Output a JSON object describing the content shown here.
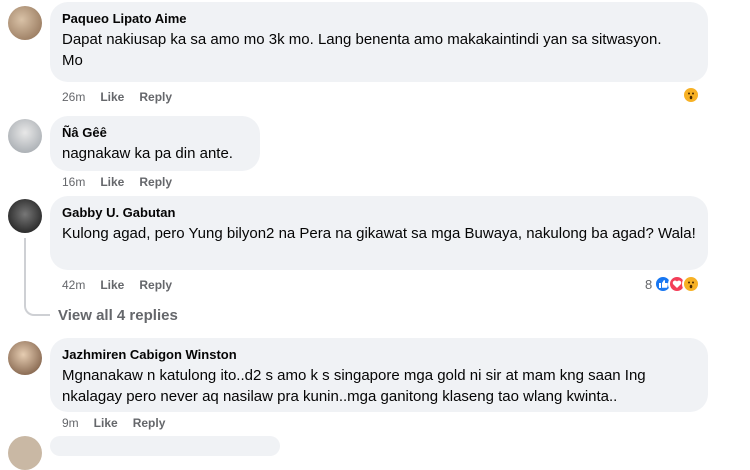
{
  "comments": [
    {
      "author": "Paqueo Lipato Aime",
      "text": "Dapat nakiusap ka sa amo mo 3k mo. Lang benenta amo makakaintindi yan sa sitwasyon. Mo",
      "time": "26m",
      "like": "Like",
      "reply": "Reply"
    },
    {
      "author": "Ñâ Gêê",
      "text": "nagnakaw ka pa din ante.",
      "time": "16m",
      "like": "Like",
      "reply": "Reply"
    },
    {
      "author": "Gabby U. Gabutan",
      "text": "Kulong agad, pero Yung bilyon2 na Pera na gikawat sa mga Buwaya, nakulong ba agad? Wala!",
      "time": "42m",
      "like": "Like",
      "reply": "Reply",
      "reaction_count": "8"
    },
    {
      "author": "Jazhmiren Cabigon Winston",
      "text": "Mgnanakaw n katulong ito..d2 s amo k s singapore mga gold ni sir at mam kng saan Ing nkalagay pero never aq nasilaw pra kunin..mga ganitong klaseng tao wlang kwinta..",
      "time": "9m",
      "like": "Like",
      "reply": "Reply"
    }
  ],
  "view_replies": "View all 4 replies",
  "colors": {
    "bubble": "#f0f2f5",
    "meta": "#65676b",
    "like_blue": "#1877f2",
    "love_red": "#f33e58",
    "wow_yellow": "#f7b125"
  },
  "icons": [
    "wow-reaction-icon",
    "like-reaction-icon",
    "love-reaction-icon"
  ]
}
